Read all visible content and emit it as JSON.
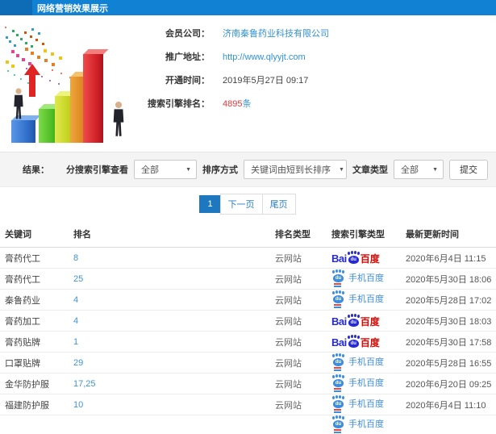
{
  "header": {
    "title": "网络营销效果展示"
  },
  "info": {
    "fields": [
      {
        "label": "会员公司：",
        "value": "济南秦鲁药业科技有限公司",
        "type": "link"
      },
      {
        "label": "推广地址：",
        "value": "http://www.qlyyjt.com",
        "type": "link"
      },
      {
        "label": "开通时间：",
        "value": "2019年5月27日 09:17",
        "type": "text"
      },
      {
        "label": "搜索引擎排名：",
        "value": "4895",
        "suffix": "条",
        "type": "highlight"
      }
    ]
  },
  "filters": {
    "result_label": "结果：",
    "engine_label": "分搜索引擎查看",
    "engine_value": "全部",
    "sort_label": "排序方式",
    "sort_value": "关键词由短到长排序",
    "article_label": "文章类型",
    "article_value": "全部",
    "submit_label": "提交"
  },
  "pagination": {
    "current": "1",
    "next": "下一页",
    "last": "尾页"
  },
  "table": {
    "headers": [
      "关键词",
      "排名",
      "排名类型",
      "搜索引擎类型",
      "最新更新时间"
    ],
    "engine_labels": {
      "baidu_bai": "Bai",
      "baidu_du": "du",
      "baidu_cn": "百度",
      "mobile_label": "手机百度"
    },
    "rows": [
      {
        "keyword": "膏药代工",
        "rank": "8",
        "rank_type": "云网站",
        "engine": "baidu",
        "time": "2020年6月4日 11:15"
      },
      {
        "keyword": "膏药代工",
        "rank": "25",
        "rank_type": "云网站",
        "engine": "mobile",
        "time": "2020年5月30日 18:06"
      },
      {
        "keyword": "秦鲁药业",
        "rank": "4",
        "rank_type": "云网站",
        "engine": "mobile",
        "time": "2020年5月28日 17:02"
      },
      {
        "keyword": "膏药加工",
        "rank": "4",
        "rank_type": "云网站",
        "engine": "baidu",
        "time": "2020年5月30日 18:03"
      },
      {
        "keyword": "膏药贴牌",
        "rank": "1",
        "rank_type": "云网站",
        "engine": "baidu",
        "time": "2020年5月30日 17:58"
      },
      {
        "keyword": "口罩贴牌",
        "rank": "29",
        "rank_type": "云网站",
        "engine": "mobile",
        "time": "2020年5月28日 16:55"
      },
      {
        "keyword": "金华防护服",
        "rank": "17,25",
        "rank_type": "云网站",
        "engine": "mobile",
        "time": "2020年6月20日 09:25"
      },
      {
        "keyword": "福建防护服",
        "rank": "10",
        "rank_type": "云网站",
        "engine": "mobile",
        "time": "2020年6月4日 11:10"
      }
    ],
    "partial_row_engine": "mobile"
  },
  "colors": {
    "topbar": "#1182d3",
    "link_blue": "#3492d2",
    "highlight_red": "#e4393c",
    "pagination_active": "#1d78c0",
    "baidu_blue": "#2529d8",
    "baidu_red": "#e10601",
    "mobile_blue": "#3e8ddd"
  }
}
